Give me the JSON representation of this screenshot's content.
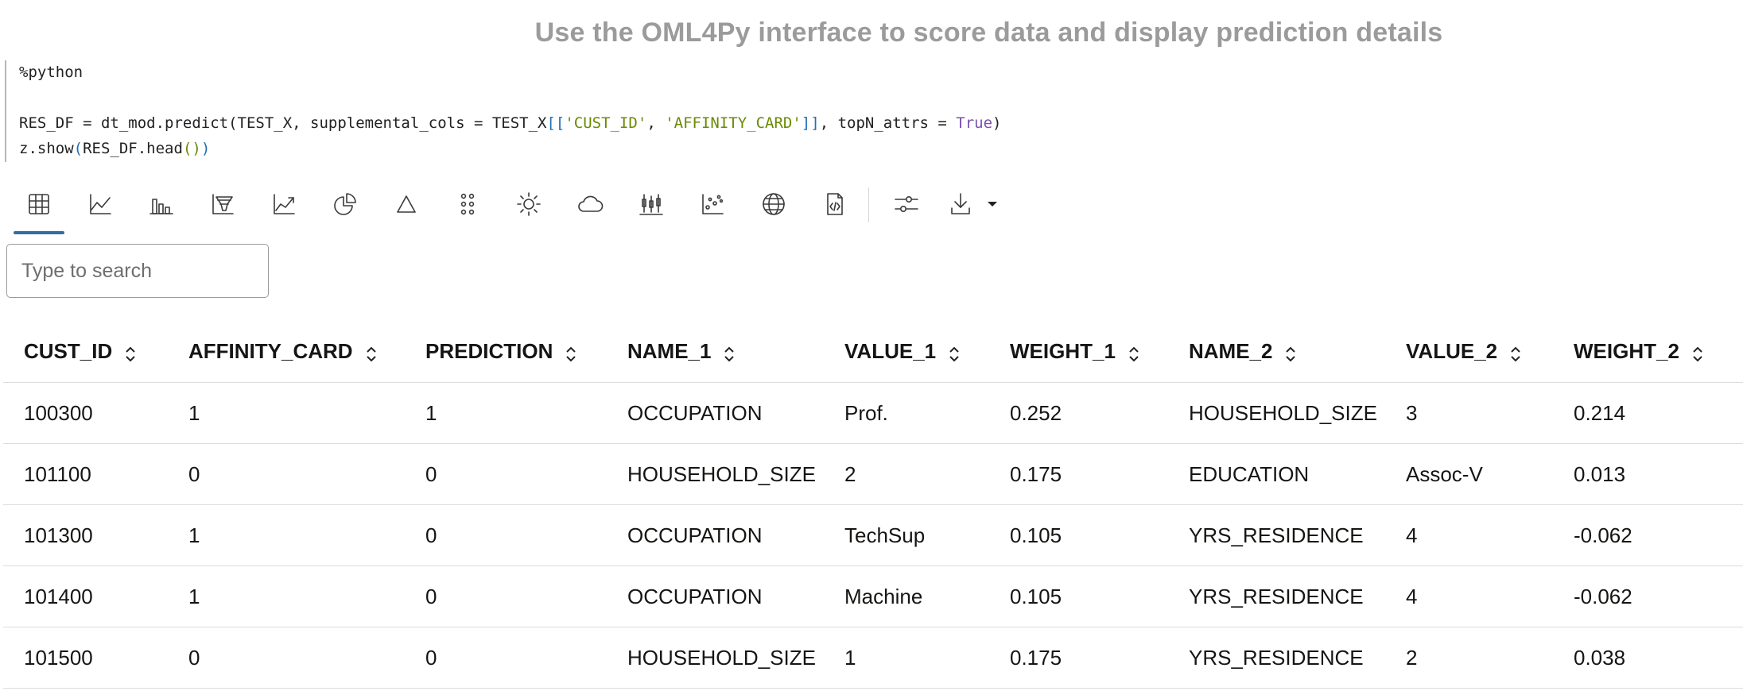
{
  "title": "Use the OML4Py interface to score data and display prediction details",
  "code": {
    "line1": "%python",
    "line2_a": "RES_DF = dt_mod.predict(TEST_X, supplemental_cols = TEST_X",
    "line2_b": "[[",
    "line2_c": "'CUST_ID'",
    "line2_d": ", ",
    "line2_e": "'AFFINITY_CARD'",
    "line2_f": "]]",
    "line2_g": ", topN_attrs = ",
    "line2_h": "True",
    "line2_i": ")",
    "line3_a": "z.show",
    "line3_b": "(",
    "line3_c": "RES_DF.head",
    "line3_d": "()",
    "line3_e": ")"
  },
  "toolbar": {
    "icons": [
      "table-icon",
      "line-chart-icon",
      "bar-chart-icon",
      "funnel-chart-icon",
      "area-chart-icon",
      "pie-chart-icon",
      "pyramid-chart-icon",
      "scatter-dots-icon",
      "sunburst-icon",
      "tag-cloud-icon",
      "box-plot-icon",
      "bubble-chart-icon",
      "globe-map-icon",
      "code-file-icon",
      "settings-sliders-icon",
      "download-icon"
    ]
  },
  "search": {
    "placeholder": "Type to search"
  },
  "table": {
    "columns": [
      "CUST_ID",
      "AFFINITY_CARD",
      "PREDICTION",
      "NAME_1",
      "VALUE_1",
      "WEIGHT_1",
      "NAME_2",
      "VALUE_2",
      "WEIGHT_2"
    ],
    "rows": [
      [
        "100300",
        "1",
        "1",
        "OCCUPATION",
        "Prof.",
        "0.252",
        "HOUSEHOLD_SIZE",
        "3",
        "0.214"
      ],
      [
        "101100",
        "0",
        "0",
        "HOUSEHOLD_SIZE",
        "2",
        "0.175",
        "EDUCATION",
        "Assoc-V",
        "0.013"
      ],
      [
        "101300",
        "1",
        "0",
        "OCCUPATION",
        "TechSup",
        "0.105",
        "YRS_RESIDENCE",
        "4",
        "-0.062"
      ],
      [
        "101400",
        "1",
        "0",
        "OCCUPATION",
        "Machine",
        "0.105",
        "YRS_RESIDENCE",
        "4",
        "-0.062"
      ],
      [
        "101500",
        "0",
        "0",
        "HOUSEHOLD_SIZE",
        "1",
        "0.175",
        "YRS_RESIDENCE",
        "2",
        "0.038"
      ]
    ]
  },
  "colors": {
    "accent": "#2f6fa5",
    "title_gray": "#9b9b9b",
    "string": "#6a8a00",
    "keyword": "#7b4fb0",
    "bracket": "#1f6fb5"
  }
}
